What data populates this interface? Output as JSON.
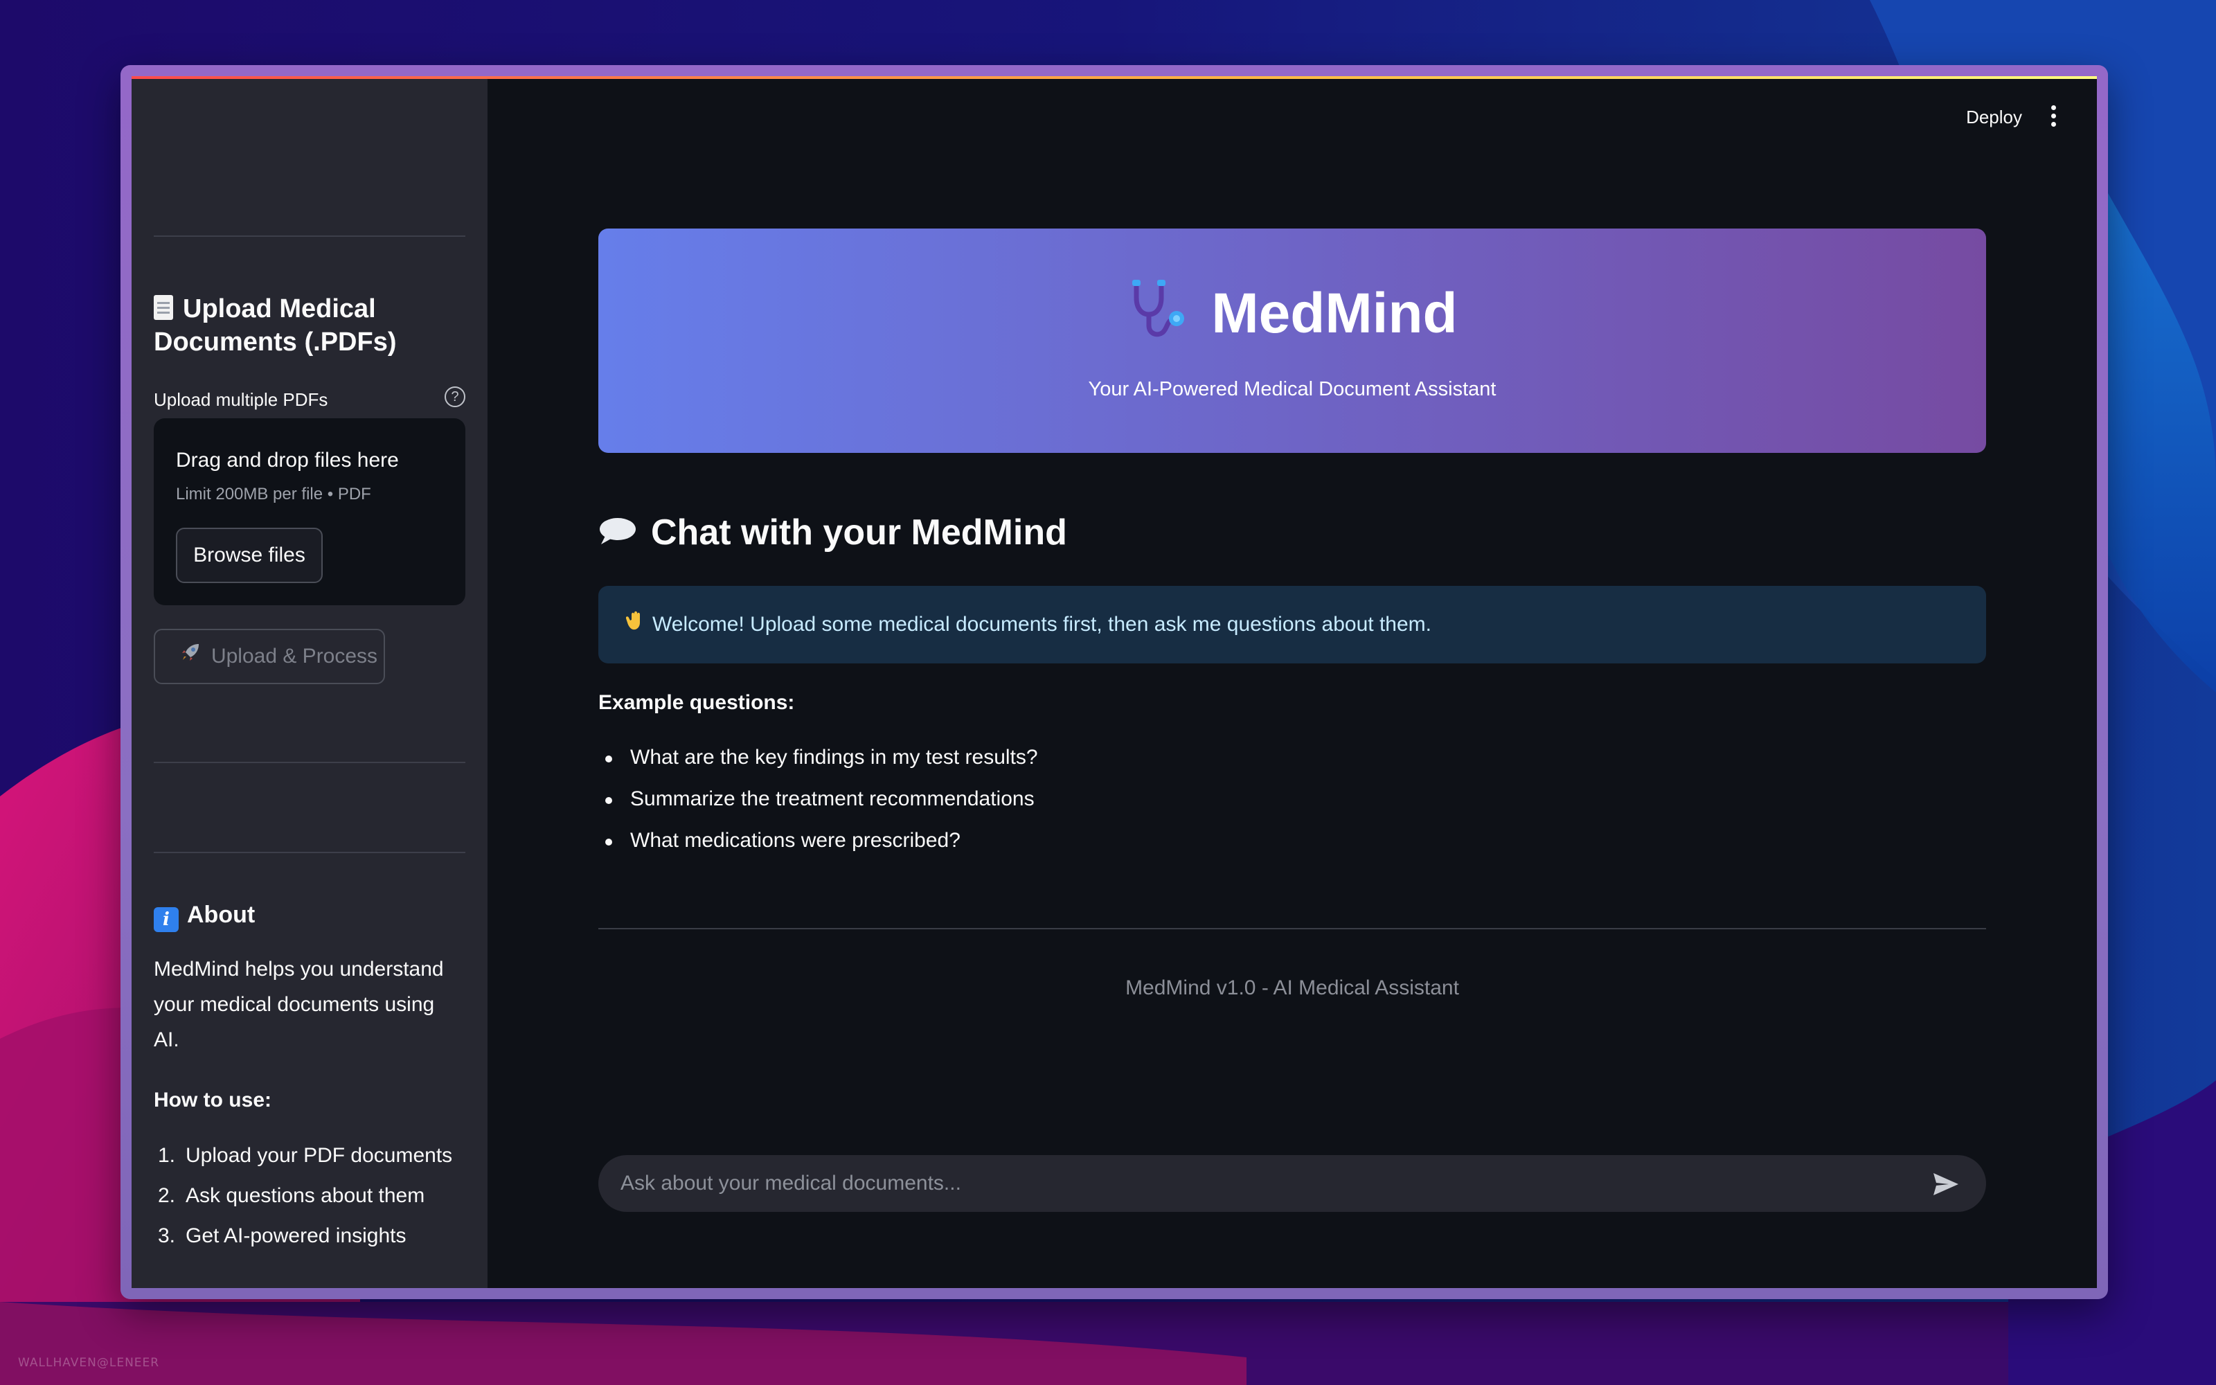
{
  "watermark": "WALLHAVEN@LENEER",
  "header": {
    "deploy_label": "Deploy"
  },
  "sidebar": {
    "upload_heading": "Upload Medical Documents (.PDFs)",
    "uploader_label": "Upload multiple PDFs",
    "dropzone_title": "Drag and drop files here",
    "dropzone_limit": "Limit 200MB per file • PDF",
    "browse_label": "Browse files",
    "upload_process_label": "Upload & Process",
    "about_heading": "About",
    "about_text": "MedMind helps you understand your medical documents using AI.",
    "howto_label": "How to use:",
    "howto_steps": [
      {
        "num": "1.",
        "text": "Upload your PDF documents"
      },
      {
        "num": "2.",
        "text": "Ask questions about them"
      },
      {
        "num": "3.",
        "text": "Get AI-powered insights"
      }
    ]
  },
  "hero": {
    "title": "MedMind",
    "subtitle": "Your AI-Powered Medical Document Assistant"
  },
  "chat": {
    "heading": "Chat with your MedMind",
    "welcome": "Welcome! Upload some medical documents first, then ask me questions about them.",
    "examples_label": "Example questions:",
    "examples": [
      "What are the key findings in my test results?",
      "Summarize the treatment recommendations",
      "What medications were prescribed?"
    ],
    "footer": "MedMind v1.0 - AI Medical Assistant",
    "input_placeholder": "Ask about your medical documents..."
  },
  "colors": {
    "hero_gradient_start": "#667eea",
    "hero_gradient_end": "#764ba2",
    "info_bg": "#172d43",
    "app_bg": "#0e1117",
    "sidebar_bg": "#262730"
  }
}
